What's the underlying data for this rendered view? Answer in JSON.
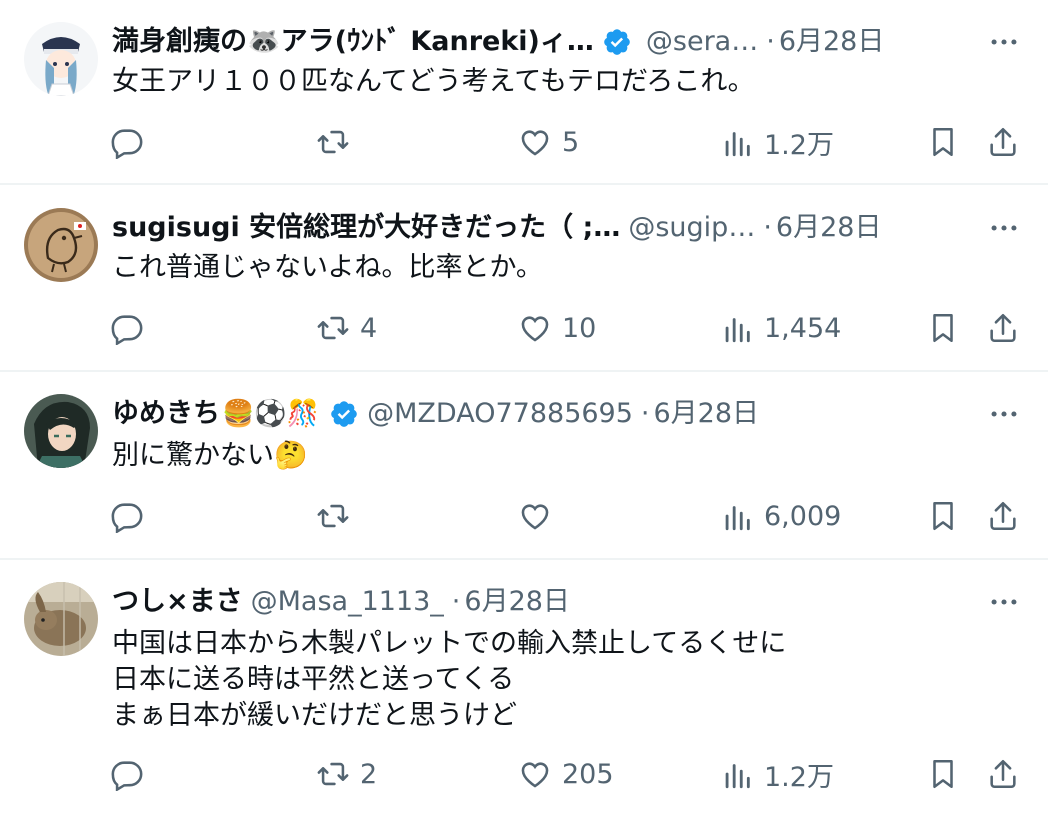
{
  "colors": {
    "text": "#0f1419",
    "secondary": "#536471",
    "verified": "#1d9bf0",
    "divider": "#eff3f4"
  },
  "tweets": [
    {
      "name": "満身創痍の🦝アラ(ｳﾝﾄﾞ Kanreki)ィ…",
      "verified": true,
      "handle": "@sera…",
      "dot": "·",
      "date": "6月28日",
      "text": "女王アリ１００匹なんてどう考えてもテロだろこれ。",
      "reply": "",
      "retweet": "",
      "like": "5",
      "views": "1.2万"
    },
    {
      "name": "sugisugi 安倍総理が大好きだった（ ;…",
      "verified": false,
      "handle": "@sugip…",
      "dot": "·",
      "date": "6月28日",
      "text": "これ普通じゃないよね。比率とか。",
      "reply": "",
      "retweet": "4",
      "like": "10",
      "views": "1,454"
    },
    {
      "name": "ゆめきち",
      "name_emoji": "🍔⚽🎊",
      "verified": true,
      "handle": "@MZDAO77885695",
      "dot": "·",
      "date": "6月28日",
      "text": "別に驚かない🤔",
      "reply": "",
      "retweet": "",
      "like": "",
      "views": "6,009"
    },
    {
      "name": "つし×まさ",
      "verified": false,
      "handle": "@Masa_1113_",
      "dot": "·",
      "date": "6月28日",
      "text": "中国は日本から木製パレットでの輸入禁止してるくせに\n日本に送る時は平然と送ってくる\nまぁ日本が緩いだけだと思うけど",
      "reply": "",
      "retweet": "2",
      "like": "205",
      "views": "1.2万"
    }
  ],
  "icons": {
    "reply": "reply-icon",
    "retweet": "retweet-icon",
    "like": "heart-icon",
    "views": "views-chart-icon",
    "bookmark": "bookmark-icon",
    "share": "share-icon",
    "more": "more-dots-icon",
    "verified": "verified-badge-icon"
  }
}
